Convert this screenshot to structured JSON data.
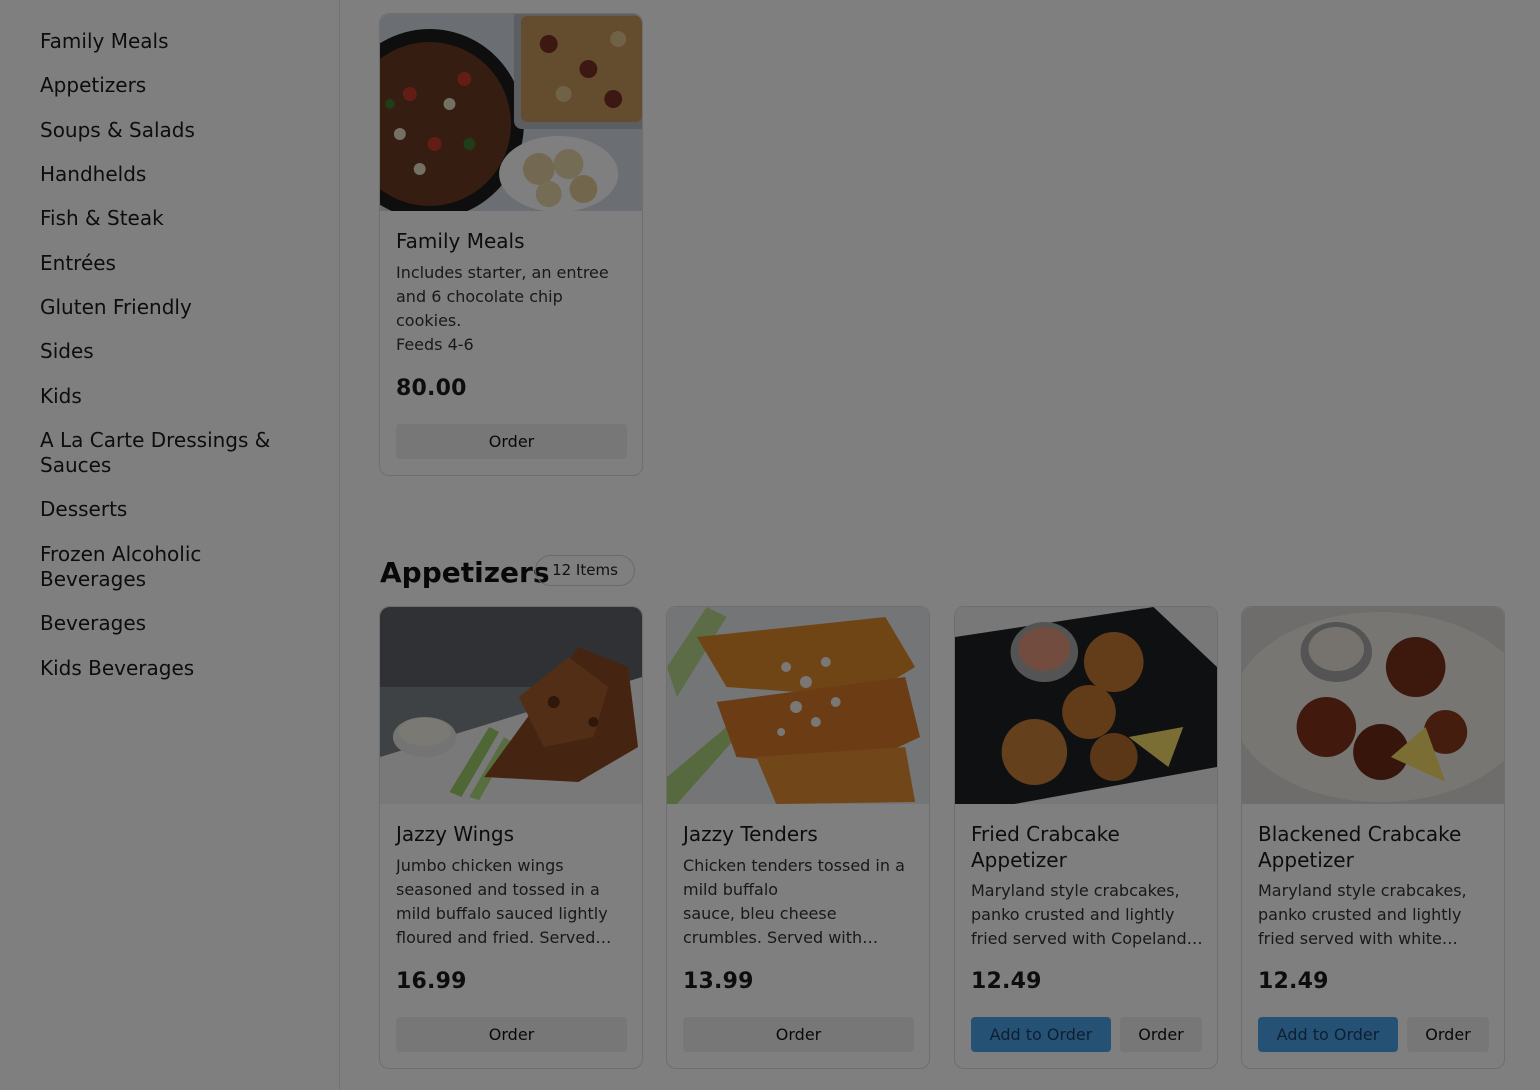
{
  "categories": [
    "Family Meals",
    "Appetizers",
    "Soups & Salads",
    "Handhelds",
    "Fish & Steak",
    "Entrées",
    "Gluten Friendly",
    "Sides",
    "Kids",
    "A La Carte Dressings & Sauces",
    "Desserts",
    "Frozen Alcoholic Beverages",
    "Beverages",
    "Kids Beverages"
  ],
  "family_meal": {
    "name": "Family Meals",
    "description": "Includes starter, an entree and 6 chocolate chip cookies.\nFeeds 4-6",
    "price": "80.00",
    "order_label": "Order"
  },
  "appetizers_section": {
    "title": "Appetizers",
    "count": "12 Items"
  },
  "appetizers": [
    {
      "name": "Jazzy Wings",
      "description": "Jumbo chicken wings seasoned and tossed in a mild buffalo sauced lightly floured and fried. Served…",
      "price": "16.99",
      "order_label": "Order"
    },
    {
      "name": "Jazzy Tenders",
      "description": "Chicken tenders tossed in a mild buffalo\nsauce, bleu cheese crumbles. Served with…",
      "price": "13.99",
      "order_label": "Order"
    },
    {
      "name": "Fried Crabcake Appetizer",
      "description": "Maryland style crabcakes, panko crusted and lightly fried served with Copeland…",
      "price": "12.49",
      "add_label": "Add to Order",
      "order_label": "Order"
    },
    {
      "name": "Blackened Crabcake Appetizer",
      "description": "Maryland style crabcakes, panko crusted and lightly fried served with white…",
      "price": "12.49",
      "add_label": "Add to Order",
      "order_label": "Order"
    }
  ],
  "colors": {
    "accent": "#4aa5e8",
    "accent_text": "#1c3d66",
    "overlay": "rgba(0,0,0,0.5)"
  }
}
